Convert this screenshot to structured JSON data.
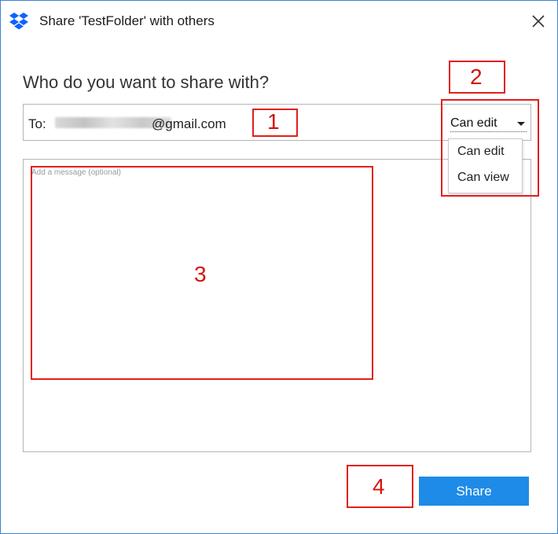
{
  "window": {
    "title": "Share 'TestFolder' with others",
    "accent": "#3c82d8"
  },
  "icons": {
    "app": "dropbox-logo-icon",
    "close": "close-icon",
    "dropdown": "caret-down-icon"
  },
  "heading": "Who do you want to share with?",
  "to_field": {
    "label": "To:",
    "email_domain": "@gmail.com"
  },
  "permission": {
    "selected": "Can edit",
    "options": [
      "Can edit",
      "Can view"
    ]
  },
  "message": {
    "placeholder": "Add a message (optional)"
  },
  "share_button": {
    "label": "Share",
    "color": "#1e8be8"
  },
  "annotations": {
    "color": "#e0201a",
    "labels": [
      "1",
      "2",
      "3",
      "4"
    ]
  }
}
